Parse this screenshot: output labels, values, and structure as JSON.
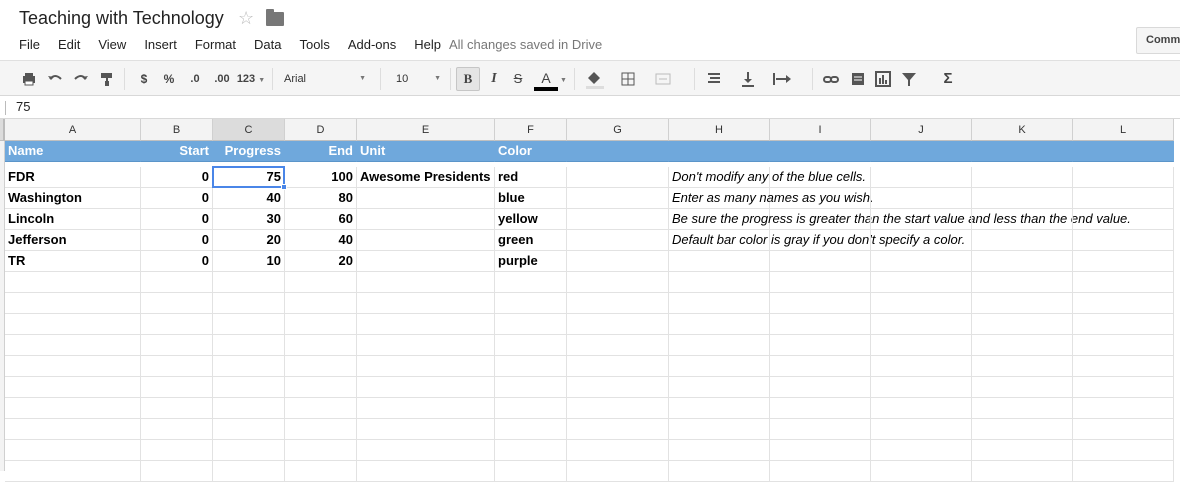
{
  "doc": {
    "title": "Teaching with Technology",
    "star_icon": "☆",
    "save_status": "All changes saved in Drive",
    "comments_label": "Comm"
  },
  "menu": [
    "File",
    "Edit",
    "View",
    "Insert",
    "Format",
    "Data",
    "Tools",
    "Add-ons",
    "Help"
  ],
  "toolbar": {
    "currency": "$",
    "percent": "%",
    "dec_decrease": ".0",
    "dec_increase": ".00",
    "more_formats": "123",
    "font": "Arial",
    "font_size": "10",
    "bold": "B",
    "italic": "I",
    "strike": "S",
    "text_color": "A",
    "icons": [
      "print-icon",
      "undo-icon",
      "redo-icon",
      "paint-format-icon",
      "fill-color-icon",
      "borders-icon",
      "merge-icon",
      "align-icon",
      "valign-icon",
      "wrap-icon",
      "link-icon",
      "comment-icon",
      "chart-icon",
      "filter-icon",
      "functions-icon"
    ]
  },
  "formula_bar": {
    "value": "75"
  },
  "columns": [
    "A",
    "B",
    "C",
    "D",
    "E",
    "F",
    "G",
    "H",
    "I",
    "J",
    "K",
    "L"
  ],
  "selected_column": "C",
  "header_row": [
    "Name",
    "Start",
    "Progress",
    "End",
    "Unit",
    "Color",
    "",
    "",
    "",
    "",
    "",
    ""
  ],
  "rows": [
    [
      "FDR",
      "0",
      "75",
      "100",
      "Awesome Presidents",
      "red",
      "",
      "Don't modify any of the blue cells.",
      "",
      "",
      "",
      ""
    ],
    [
      "Washington",
      "0",
      "40",
      "80",
      "",
      "blue",
      "",
      "Enter as many names as you wish.",
      "",
      "",
      "",
      ""
    ],
    [
      "Lincoln",
      "0",
      "30",
      "60",
      "",
      "yellow",
      "",
      "Be sure the progress is greater than the start value and less than the end value.",
      "",
      "",
      "",
      ""
    ],
    [
      "Jefferson",
      "0",
      "20",
      "40",
      "",
      "green",
      "",
      "Default bar color is gray if you don't specify a color.",
      "",
      "",
      "",
      ""
    ],
    [
      "TR",
      "0",
      "10",
      "20",
      "",
      "purple",
      "",
      "",
      "",
      "",
      "",
      ""
    ]
  ],
  "selected_cell": {
    "col": "C",
    "row": 1
  }
}
